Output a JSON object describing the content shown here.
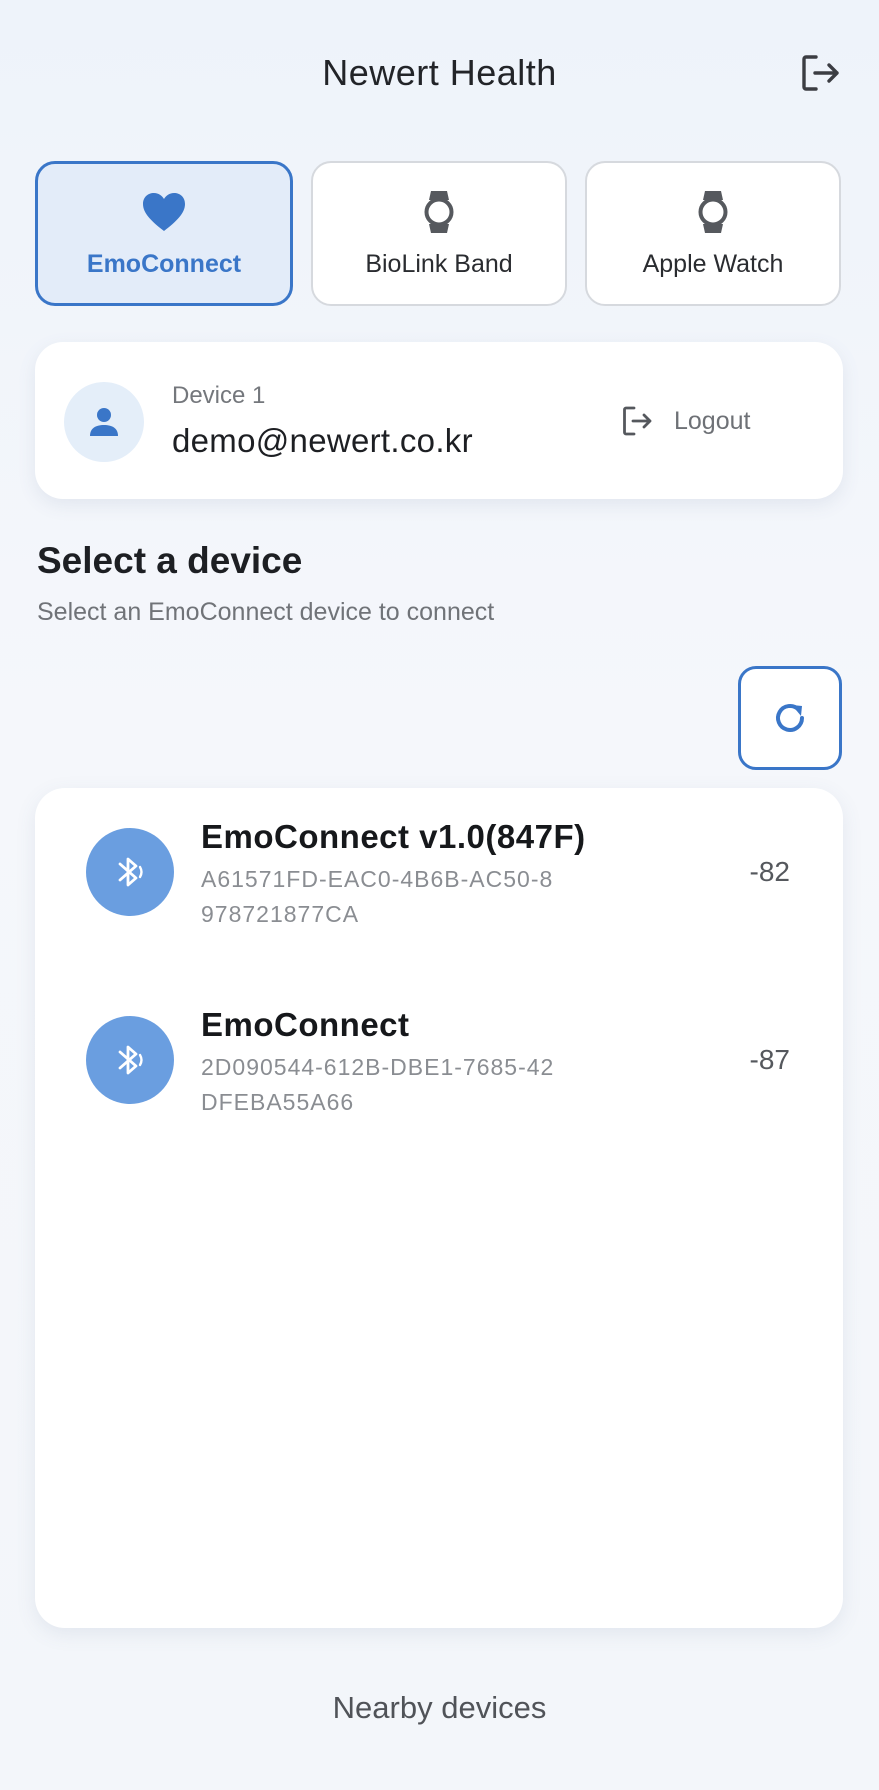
{
  "header": {
    "title": "Newert Health",
    "logout_icon": "logout-icon"
  },
  "tabs": [
    {
      "label": "EmoConnect",
      "icon": "heart-icon",
      "active": true
    },
    {
      "label": "BioLink Band",
      "icon": "watch-icon",
      "active": false
    },
    {
      "label": "Apple Watch",
      "icon": "watch-icon",
      "active": false
    }
  ],
  "account": {
    "device_label": "Device 1",
    "email": "demo@newert.co.kr",
    "logout_label": "Logout",
    "avatar_icon": "person-icon"
  },
  "section": {
    "title": "Select a device",
    "subtitle": "Select an EmoConnect device to connect",
    "refresh_icon": "refresh-icon"
  },
  "devices": [
    {
      "name": "EmoConnect v1.0(847F)",
      "id": "A61571FD-EAC0-4B6B-AC50-8978721877CA",
      "rssi": "-82",
      "icon": "bluetooth-icon"
    },
    {
      "name": "EmoConnect",
      "id": "2D090544-612B-DBE1-7685-42DFEBA55A66",
      "rssi": "-87",
      "icon": "bluetooth-icon"
    }
  ],
  "footer": {
    "label": "Nearby devices"
  },
  "colors": {
    "accent": "#3a76c8",
    "accent_light": "#e3ecf9",
    "bluetooth_bg": "#6a9ee0"
  }
}
